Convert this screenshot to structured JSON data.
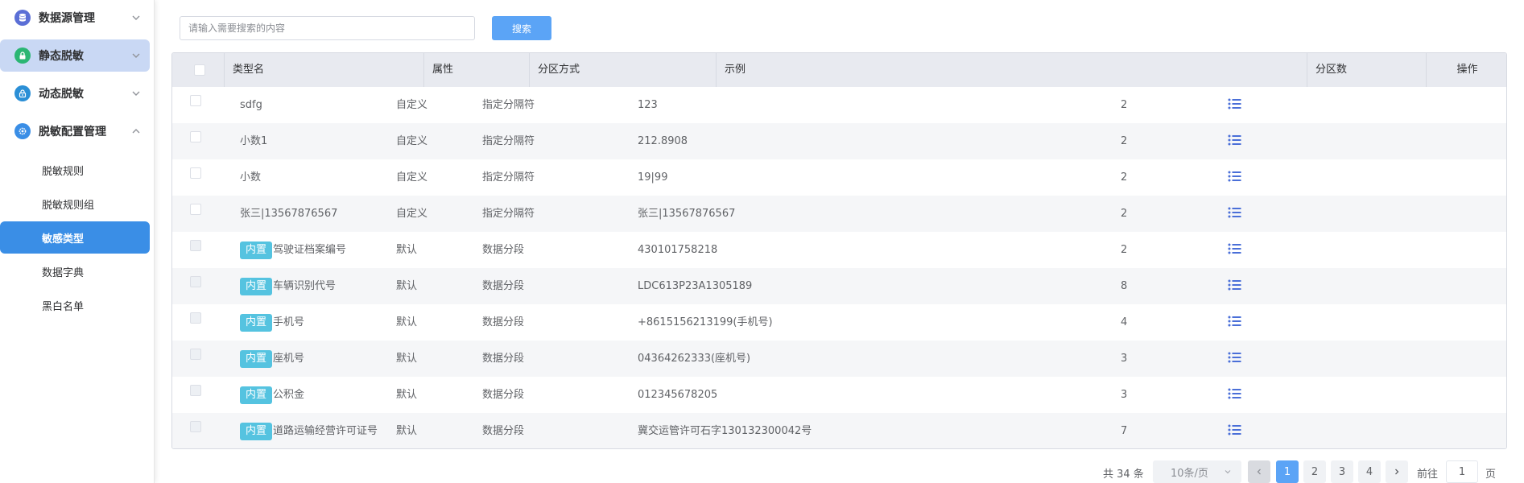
{
  "sidebar": {
    "menus": [
      {
        "label": "数据源管理",
        "icon": "database-icon",
        "expanded": false
      },
      {
        "label": "静态脱敏",
        "icon": "lock-icon",
        "expanded": false
      },
      {
        "label": "动态脱敏",
        "icon": "dynamic-lock-icon",
        "expanded": false
      },
      {
        "label": "脱敏配置管理",
        "icon": "gear-icon",
        "expanded": true
      }
    ],
    "sub_items": [
      {
        "label": "脱敏规则"
      },
      {
        "label": "脱敏规则组"
      },
      {
        "label": "敏感类型"
      },
      {
        "label": "数据字典"
      },
      {
        "label": "黑白名单"
      }
    ]
  },
  "search": {
    "placeholder": "请输入需要搜索的内容",
    "value": "",
    "button_label": "搜索"
  },
  "table": {
    "columns": [
      "类型名",
      "属性",
      "分区方式",
      "示例",
      "分区数",
      "操作"
    ],
    "rows": [
      {
        "builtin": false,
        "name": "sdfg",
        "attr": "自定义",
        "method": "指定分隔符",
        "example": "123",
        "count": "2"
      },
      {
        "builtin": false,
        "name": "小数1",
        "attr": "自定义",
        "method": "指定分隔符",
        "example": "212.8908",
        "count": "2"
      },
      {
        "builtin": false,
        "name": "小数",
        "attr": "自定义",
        "method": "指定分隔符",
        "example": "19|99",
        "count": "2"
      },
      {
        "builtin": false,
        "name": "张三|13567876567",
        "attr": "自定义",
        "method": "指定分隔符",
        "example": "张三|13567876567",
        "count": "2"
      },
      {
        "builtin": true,
        "name": "驾驶证档案编号",
        "attr": "默认",
        "method": "数据分段",
        "example": "430101758218",
        "count": "2"
      },
      {
        "builtin": true,
        "name": "车辆识别代号",
        "attr": "默认",
        "method": "数据分段",
        "example": "LDC613P23A1305189",
        "count": "8"
      },
      {
        "builtin": true,
        "name": "手机号",
        "attr": "默认",
        "method": "数据分段",
        "example": "+8615156213199(手机号)",
        "count": "4"
      },
      {
        "builtin": true,
        "name": "座机号",
        "attr": "默认",
        "method": "数据分段",
        "example": "04364262333(座机号)",
        "count": "3"
      },
      {
        "builtin": true,
        "name": "公积金",
        "attr": "默认",
        "method": "数据分段",
        "example": "012345678205",
        "count": "3"
      },
      {
        "builtin": true,
        "name": "道路运输经营许可证号",
        "attr": "默认",
        "method": "数据分段",
        "example": "冀交运管许可石字130132300042号",
        "count": "7"
      }
    ],
    "builtin_badge": "内置",
    "op_icon": "list-icon"
  },
  "pagination": {
    "total_text": "共 34 条",
    "page_size": "10条/页",
    "pages": [
      "1",
      "2",
      "3",
      "4"
    ],
    "current_page": "1",
    "goto_label": "前往",
    "goto_value": "1",
    "page_suffix": "页"
  },
  "colors": {
    "primary": "#5ba4f6",
    "active_menu_bg": "#c9d8f4",
    "selected_sub_bg": "#3a8ee6",
    "badge": "#55c3e0",
    "op_icon": "#4a6fd8"
  }
}
